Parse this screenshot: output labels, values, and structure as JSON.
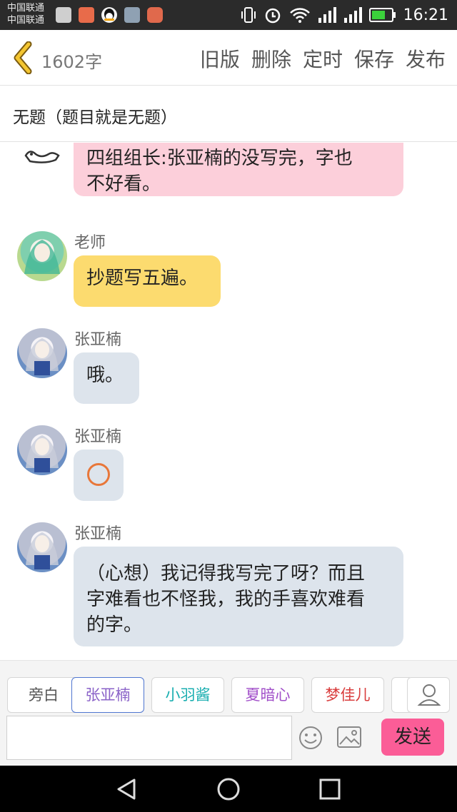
{
  "status_bar": {
    "carrier_line1": "中国联通",
    "carrier_line2": "中国联通",
    "time": "16:21"
  },
  "toolbar": {
    "word_count": "1602字",
    "actions": [
      "旧版",
      "删除",
      "定时",
      "保存",
      "发布"
    ]
  },
  "title": "无题（题目就是无题）",
  "messages": [
    {
      "sender": "",
      "avatar": "doodle-avatar",
      "text_line1": "四组组长:张亚楠的没写完，字也",
      "text_line2": "不好看。",
      "color": "#fccfda"
    },
    {
      "sender": "老师",
      "avatar": "teacher-avatar",
      "text": "抄题写五遍。",
      "color": "#fcdb6f"
    },
    {
      "sender": "张亚楠",
      "avatar": "zhang-avatar",
      "text": "哦。",
      "color": "#dde4ec"
    },
    {
      "sender": "张亚楠",
      "avatar": "zhang-avatar",
      "icon": "circle-icon",
      "color": "#dde4ec"
    },
    {
      "sender": "张亚楠",
      "avatar": "zhang-avatar",
      "text_line1": "（心想）我记得我写完了呀？而且",
      "text_line2": "字难看也不怪我，我的手喜欢难看",
      "text_line3": "的字。",
      "color": "#dde4ec"
    }
  ],
  "characters": [
    {
      "label": "旁白",
      "color": "#555555"
    },
    {
      "label": "张亚楠",
      "color": "#8a62c8"
    },
    {
      "label": "小羽酱",
      "color": "#1aaeb0"
    },
    {
      "label": "夏暗心",
      "color": "#a14fc9"
    },
    {
      "label": "梦佳儿",
      "color": "#d93c3c"
    }
  ],
  "input": {
    "placeholder": "",
    "value": ""
  },
  "send_label": "发送",
  "colors": {
    "accent_send": "#fb5d97",
    "active_chip_border": "#4f76d0"
  }
}
